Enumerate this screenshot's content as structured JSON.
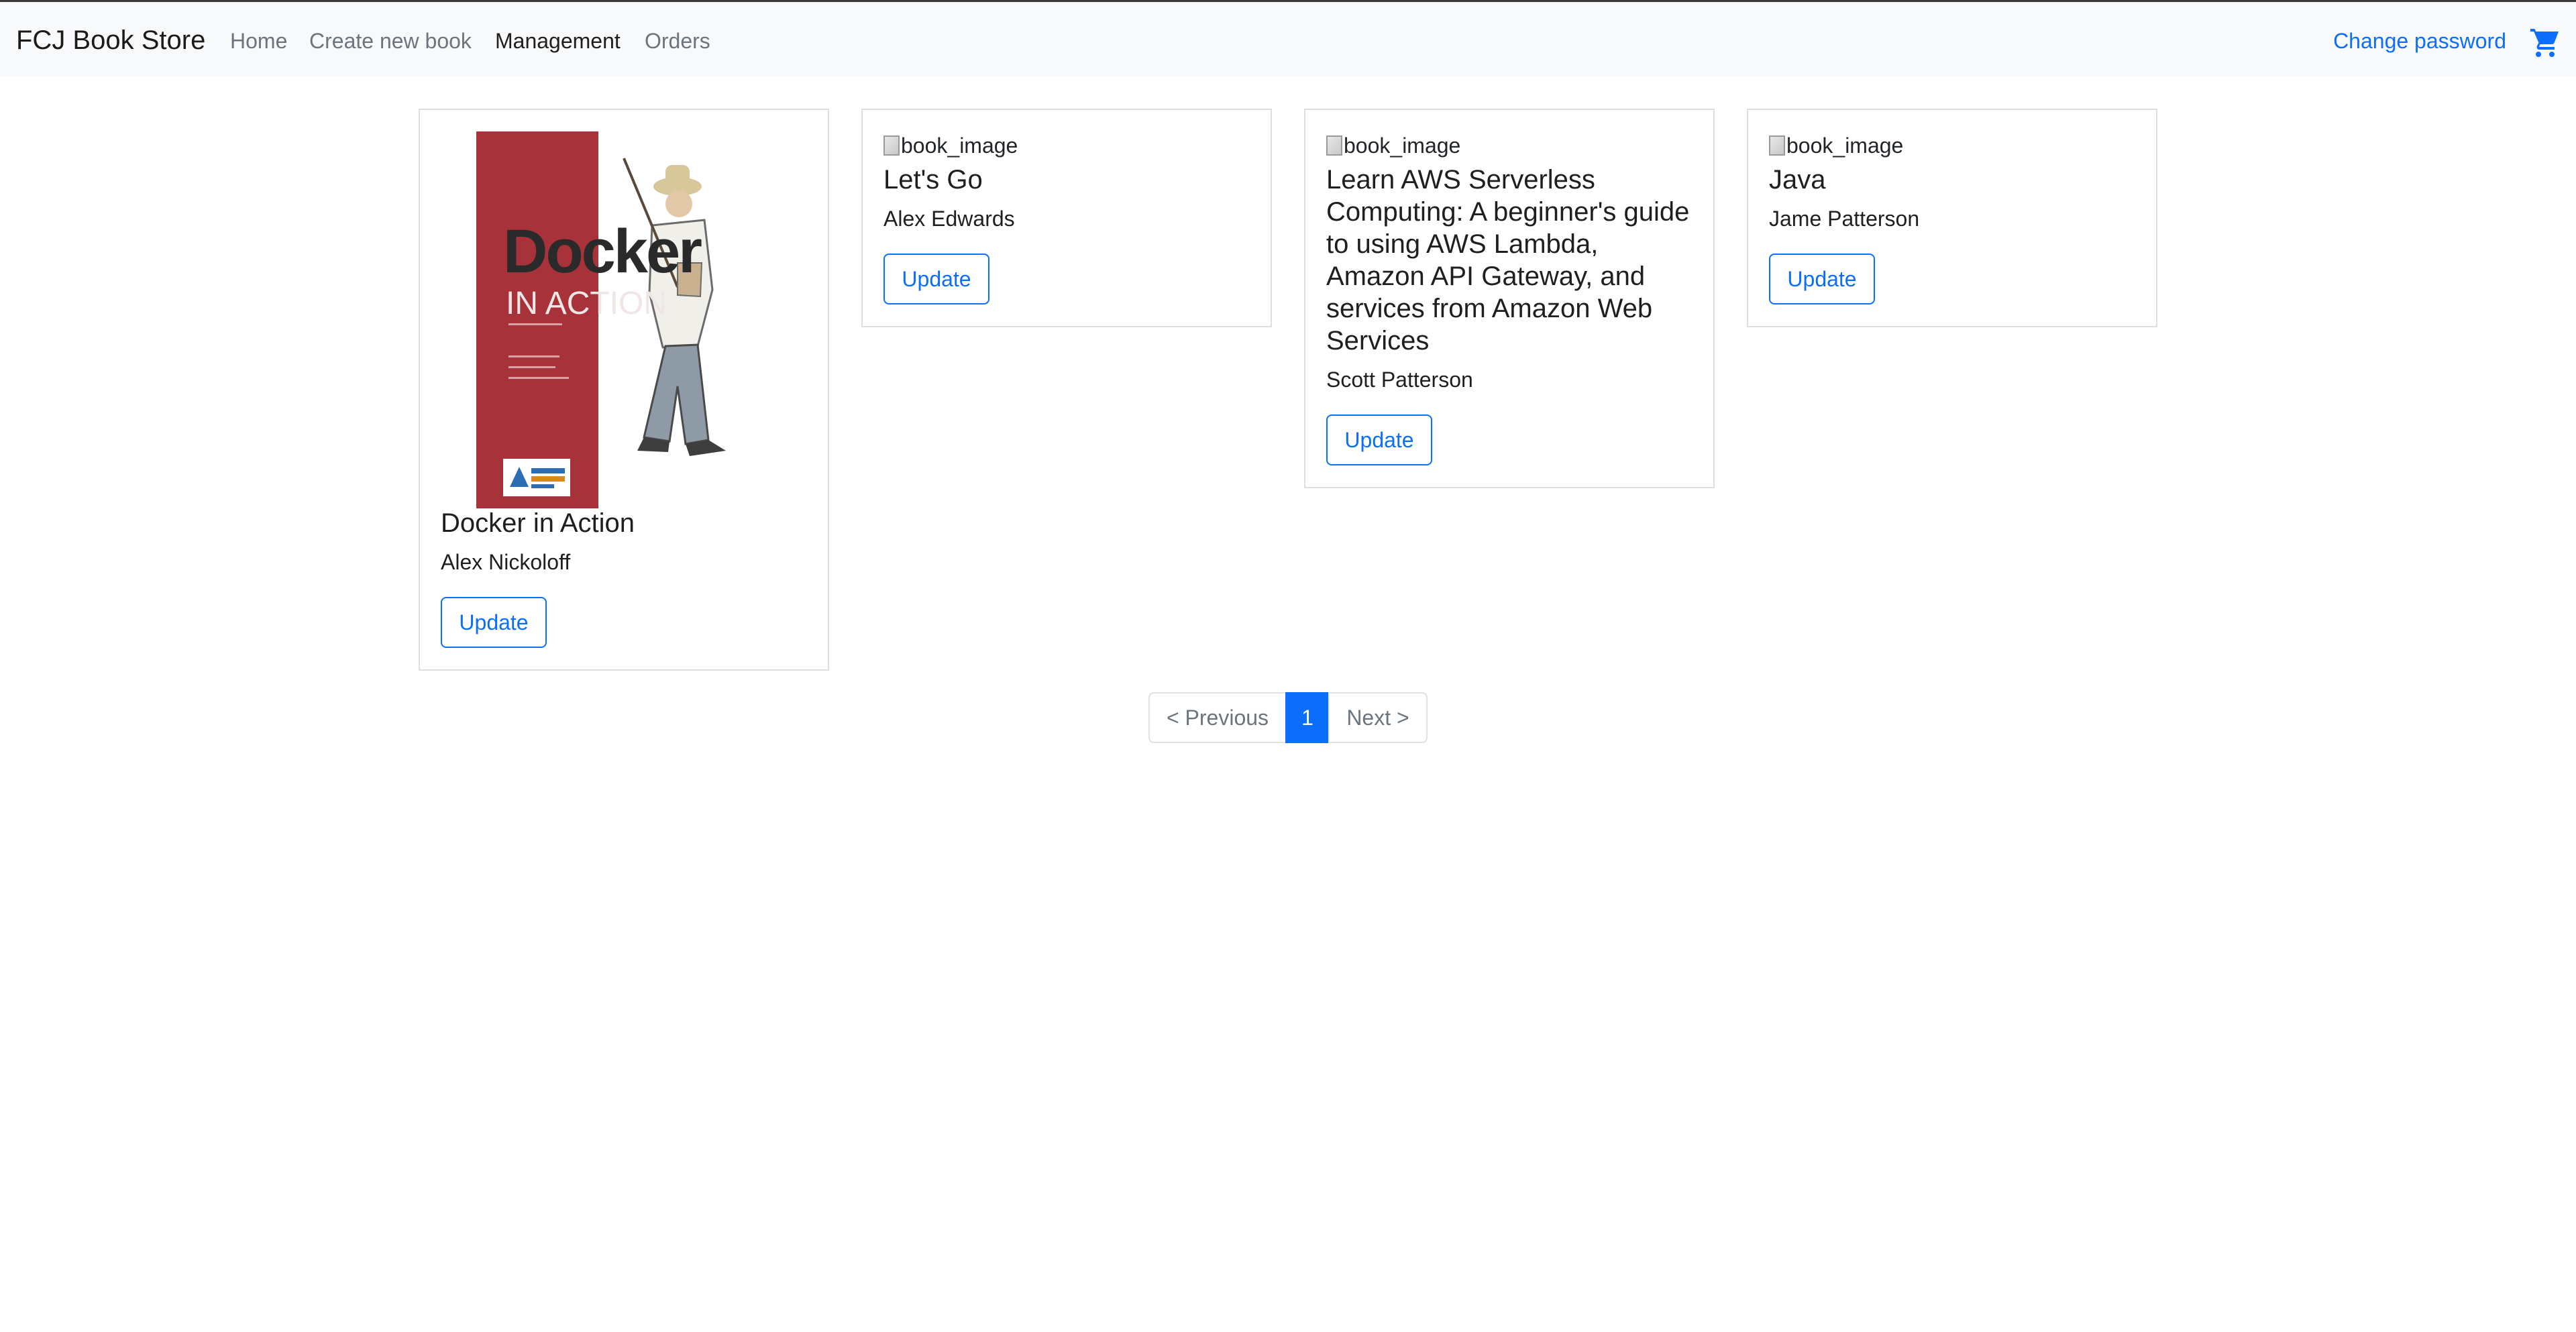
{
  "navbar": {
    "brand": "FCJ Book Store",
    "links": [
      {
        "label": "Home",
        "active": false
      },
      {
        "label": "Create new book",
        "active": false
      },
      {
        "label": "Management",
        "active": true
      },
      {
        "label": "Orders",
        "active": false
      }
    ],
    "change_password": "Change password",
    "cart_icon": "cart-icon"
  },
  "books": [
    {
      "title": "Docker in Action",
      "author": "Alex Nickoloff",
      "image": "cover",
      "cover_title": "Docker",
      "cover_subtitle": "IN ACTION",
      "update_label": "Update"
    },
    {
      "title": "Let's Go",
      "author": "Alex Edwards",
      "image_alt": "book_image",
      "update_label": "Update"
    },
    {
      "title": "Learn AWS Serverless Computing: A beginner's guide to using AWS Lambda, Amazon API Gateway, and services from Amazon Web Services",
      "author": "Scott Patterson",
      "image_alt": "book_image",
      "update_label": "Update"
    },
    {
      "title": "Java",
      "author": "Jame Patterson",
      "image_alt": "book_image",
      "update_label": "Update"
    }
  ],
  "pagination": {
    "previous": "< Previous",
    "current": "1",
    "next": "Next >"
  },
  "colors": {
    "accent": "#0d6efd",
    "navbar_bg": "#f8f9fa",
    "cover_red": "#a8323a"
  }
}
